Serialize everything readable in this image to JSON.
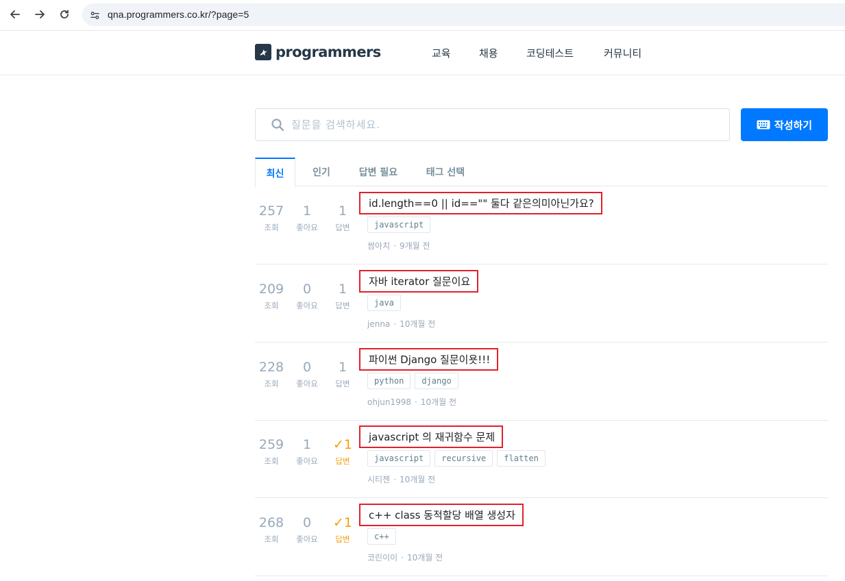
{
  "browser": {
    "url": "qna.programmers.co.kr/?page=5"
  },
  "header": {
    "logo_text": "programmers",
    "nav": [
      "교육",
      "채용",
      "코딩테스트",
      "커뮤니티"
    ]
  },
  "search": {
    "placeholder": "질문을 검색하세요.",
    "value": ""
  },
  "write_button": {
    "label": "작성하기"
  },
  "tabs": [
    "최신",
    "인기",
    "답변 필요",
    "태그 선택"
  ],
  "stat_labels": {
    "views": "조회",
    "likes": "좋아요",
    "answers": "답변"
  },
  "questions": [
    {
      "views": "257",
      "likes": "1",
      "answers": "1",
      "answered": false,
      "title": "id.length==0 || id==\"\" 둘다 같은의미아닌가요?",
      "tags": [
        "javascript"
      ],
      "author": "쌈아치",
      "time": "9개월 전"
    },
    {
      "views": "209",
      "likes": "0",
      "answers": "1",
      "answered": false,
      "title": "자바 iterator 질문이요",
      "tags": [
        "java"
      ],
      "author": "jenna",
      "time": "10개월 전"
    },
    {
      "views": "228",
      "likes": "0",
      "answers": "1",
      "answered": false,
      "title": "파이썬 Django 질문이욧!!!",
      "tags": [
        "python",
        "django"
      ],
      "author": "ohjun1998",
      "time": "10개월 전"
    },
    {
      "views": "259",
      "likes": "1",
      "answers": "✓1",
      "answered": true,
      "title": "javascript 의 재귀함수 문제",
      "tags": [
        "javascript",
        "recursive",
        "flatten"
      ],
      "author": "시티젠",
      "time": "10개월 전"
    },
    {
      "views": "268",
      "likes": "0",
      "answers": "✓1",
      "answered": true,
      "title": "c++ class 동적할당 배열 생성자",
      "tags": [
        "c++"
      ],
      "author": "코린이이",
      "time": "10개월 전"
    }
  ]
}
